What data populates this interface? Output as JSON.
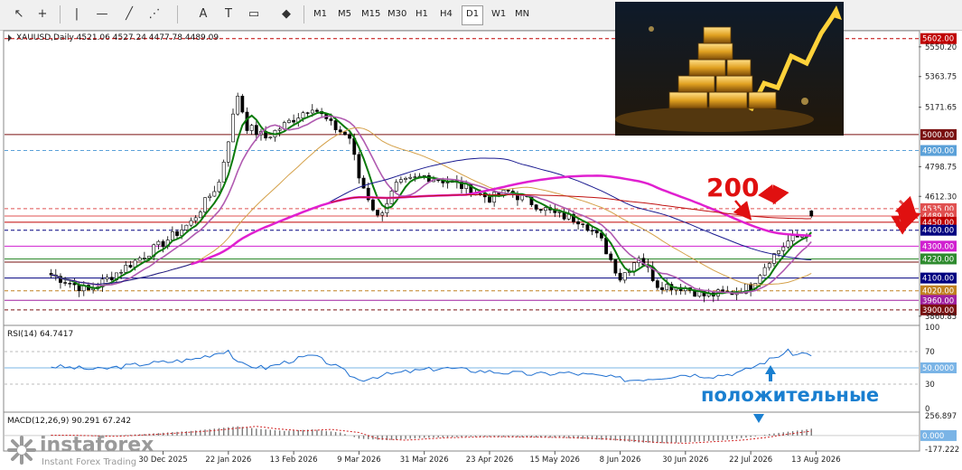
{
  "toolbar": {
    "tools": [
      "cursor-tool",
      "crosshair-tool",
      "vertical-line-tool",
      "horizontal-line-tool",
      "trendline-tool",
      "channel-tool",
      "text-tool",
      "label-tool",
      "rectangle-tool",
      "shapes-tool"
    ],
    "tool_glyphs": [
      "↖",
      "+",
      "|",
      "—",
      "╱",
      "⋰",
      "A",
      "T",
      "▭",
      "◆"
    ],
    "timeframes": [
      "M1",
      "M5",
      "M15",
      "M30",
      "H1",
      "H4",
      "D1",
      "W1",
      "MN"
    ],
    "active_timeframe": "D1"
  },
  "chart_data": [
    {
      "type": "candlestick",
      "header": "XAUUSD,Daily  4521.06 4527.24 4477.78 4489.09",
      "symbol": "XAUUSD",
      "timeframe": "Daily",
      "ohlc_last": {
        "open": 4521.06,
        "high": 4527.24,
        "low": 4477.78,
        "close": 4489.09
      },
      "ylim": [
        3820,
        5640
      ],
      "y_tick_labels": [
        "5550.20",
        "5363.75",
        "5171.65",
        "4798.75",
        "4612.30",
        "3860.85"
      ],
      "x_tick_labels": [
        "30 Dec 2025",
        "22 Jan 2026",
        "13 Feb 2026",
        "9 Mar 2026",
        "31 Mar 2026",
        "23 Apr 2026",
        "15 May 2026",
        "8 Jun 2026",
        "30 Jun 2026",
        "22 Jul 2026",
        "13 Aug 2026"
      ],
      "x_tick_positions": [
        24,
        38,
        52,
        66,
        80,
        94,
        108,
        122,
        136,
        150,
        164
      ],
      "x_range": [
        -10,
        186
      ],
      "closes_keypoints": [
        [
          0,
          4120
        ],
        [
          8,
          4020
        ],
        [
          16,
          4170
        ],
        [
          24,
          4320
        ],
        [
          30,
          4450
        ],
        [
          36,
          4700
        ],
        [
          40,
          5250
        ],
        [
          42,
          5050
        ],
        [
          46,
          4980
        ],
        [
          52,
          5100
        ],
        [
          56,
          5180
        ],
        [
          60,
          5060
        ],
        [
          64,
          4980
        ],
        [
          66,
          4730
        ],
        [
          70,
          4480
        ],
        [
          74,
          4680
        ],
        [
          80,
          4740
        ],
        [
          86,
          4700
        ],
        [
          90,
          4650
        ],
        [
          94,
          4600
        ],
        [
          98,
          4640
        ],
        [
          104,
          4560
        ],
        [
          108,
          4500
        ],
        [
          114,
          4460
        ],
        [
          118,
          4330
        ],
        [
          122,
          4100
        ],
        [
          126,
          4240
        ],
        [
          130,
          4060
        ],
        [
          136,
          4040
        ],
        [
          140,
          3990
        ],
        [
          146,
          4010
        ],
        [
          150,
          4050
        ],
        [
          154,
          4220
        ],
        [
          158,
          4330
        ],
        [
          162,
          4380
        ],
        [
          163,
          4489.09
        ]
      ],
      "price_levels": [
        {
          "price": 5602.0,
          "label": "5602.00",
          "color": "#c00000",
          "style": "dashed"
        },
        {
          "price": 5000.0,
          "label": "5000.00",
          "color": "#7a1010",
          "style": "solid"
        },
        {
          "price": 4900.0,
          "label": "4900.00",
          "color": "#5aa0d8",
          "style": "dashed"
        },
        {
          "price": 4535.0,
          "label": "4535.00",
          "color": "#e05050",
          "style": "dashed"
        },
        {
          "price": 4489.09,
          "label": "4489.09",
          "color": "#e05050",
          "style": "solid"
        },
        {
          "price": 4450.0,
          "label": "4450.00",
          "color": "#c00000",
          "style": "solid"
        },
        {
          "price": 4400.0,
          "label": "4400.00",
          "color": "#000080",
          "style": "dashed"
        },
        {
          "price": 4300.0,
          "label": "4300.00",
          "color": "#d020d0",
          "style": "solid"
        },
        {
          "price": 4220.0,
          "label": "4220.00",
          "color": "#2e8b2e",
          "style": "solid"
        },
        {
          "price": 4200.0,
          "label": "",
          "color": "#7a1010",
          "style": "solid"
        },
        {
          "price": 4100.0,
          "label": "4100.00",
          "color": "#000080",
          "style": "solid"
        },
        {
          "price": 4020.0,
          "label": "4020.00",
          "color": "#c08020",
          "style": "dashed"
        },
        {
          "price": 3960.0,
          "label": "3960.00",
          "color": "#a020a0",
          "style": "solid"
        },
        {
          "price": 3900.0,
          "label": "3900.00",
          "color": "#7a1010",
          "style": "dashed"
        }
      ],
      "annotations": [
        {
          "text": "200",
          "color": "#e01010"
        }
      ]
    },
    {
      "type": "line",
      "title": "RSI(14) 64.7417",
      "ylim": [
        0,
        100
      ],
      "y_tick_labels": [
        "100",
        "70",
        "50.0000",
        "30",
        "0"
      ],
      "levels": [
        70,
        50,
        30
      ],
      "values_keypoints": [
        [
          0,
          52
        ],
        [
          10,
          48
        ],
        [
          20,
          55
        ],
        [
          30,
          60
        ],
        [
          38,
          72
        ],
        [
          40,
          55
        ],
        [
          46,
          50
        ],
        [
          52,
          60
        ],
        [
          56,
          65
        ],
        [
          60,
          55
        ],
        [
          66,
          35
        ],
        [
          70,
          40
        ],
        [
          76,
          45
        ],
        [
          84,
          50
        ],
        [
          90,
          47
        ],
        [
          98,
          44
        ],
        [
          104,
          42
        ],
        [
          110,
          44
        ],
        [
          118,
          40
        ],
        [
          124,
          35
        ],
        [
          130,
          38
        ],
        [
          136,
          42
        ],
        [
          142,
          40
        ],
        [
          148,
          45
        ],
        [
          152,
          55
        ],
        [
          156,
          65
        ],
        [
          158,
          70
        ],
        [
          160,
          66
        ],
        [
          162,
          70
        ],
        [
          163,
          64.74
        ]
      ],
      "annotations": [
        {
          "text": "положительные",
          "color": "#1a7fd0"
        }
      ]
    },
    {
      "type": "bar",
      "title": "MACD(12,26,9) 90.291 67.242",
      "ylim": [
        -177.222,
        256.897
      ],
      "y_tick_labels": [
        "256.897",
        "0.000",
        "-177.222"
      ],
      "values_keypoints": [
        [
          0,
          5
        ],
        [
          10,
          -10
        ],
        [
          20,
          20
        ],
        [
          30,
          60
        ],
        [
          40,
          120
        ],
        [
          44,
          90
        ],
        [
          50,
          60
        ],
        [
          56,
          80
        ],
        [
          62,
          40
        ],
        [
          66,
          -40
        ],
        [
          72,
          -60
        ],
        [
          80,
          -30
        ],
        [
          90,
          -15
        ],
        [
          100,
          -20
        ],
        [
          110,
          -30
        ],
        [
          120,
          -60
        ],
        [
          126,
          -90
        ],
        [
          132,
          -100
        ],
        [
          138,
          -80
        ],
        [
          144,
          -60
        ],
        [
          150,
          -20
        ],
        [
          154,
          20
        ],
        [
          158,
          50
        ],
        [
          162,
          80
        ],
        [
          163,
          90
        ]
      ]
    }
  ],
  "photo": {
    "name": "gold-bars-photo"
  },
  "watermark": {
    "brand": "instaforex",
    "tagline": "Instant Forex Trading"
  }
}
